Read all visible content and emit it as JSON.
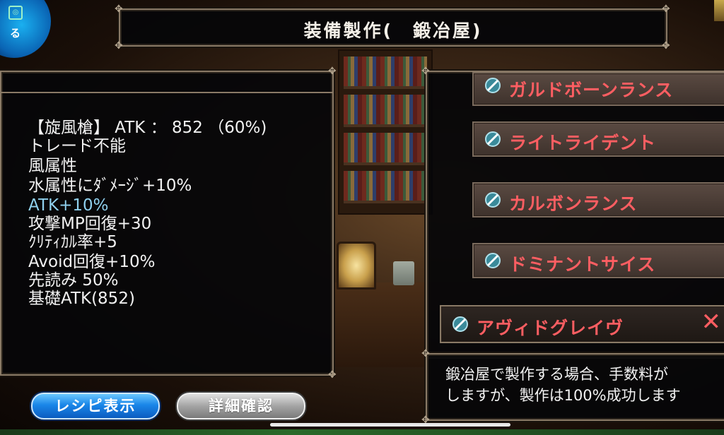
{
  "header": {
    "title": "装備製作(　鍛冶屋)"
  },
  "emblem": {
    "icon": "menu-icon",
    "label": "る"
  },
  "item_stats": {
    "lines": [
      "【旋風槍】 ATK ： 852 （60%)",
      "トレード不能",
      "風属性",
      "水属性にﾀﾞﾒｰｼﾞ+10%",
      "ATK+10%",
      "攻撃MP回復+30",
      "ｸﾘﾃｨｶﾙ率+5",
      "Avoid回復+10%",
      "先読み 50%",
      "基礎ATK(852)"
    ],
    "highlight_color": "#8fd0ee"
  },
  "recipes": {
    "items": [
      {
        "label": "ガルドボーンランス",
        "icon": "spear-icon"
      },
      {
        "label": "ライトライデント",
        "icon": "spear-icon"
      },
      {
        "label": "カルボンランス",
        "icon": "spear-icon"
      },
      {
        "label": "ドミナントサイス",
        "icon": "spear-icon"
      },
      {
        "label": "アヴィドグレイヴ",
        "icon": "spear-icon",
        "selected": true
      }
    ],
    "label_color": "#ff5e62",
    "close_symbol": "✕"
  },
  "description": {
    "line1": "鍛冶屋で製作する場合、手数料が",
    "line2": "しますが、製作は100%成功します"
  },
  "buttons": {
    "recipe": "レシピ表示",
    "details": "詳細確認"
  }
}
